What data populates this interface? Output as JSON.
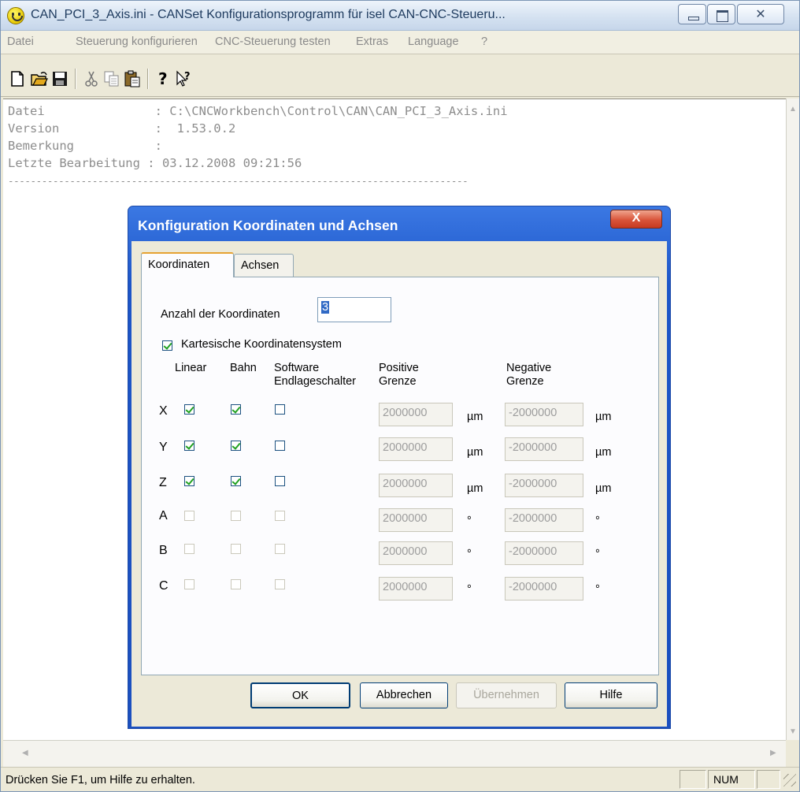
{
  "window": {
    "title": "CAN_PCI_3_Axis.ini - CANSet Konfigurationsprogramm für isel CAN-CNC-Steueru...",
    "close_glyph": "✕"
  },
  "menu": [
    "Datei",
    "Steuerung konfigurieren",
    "CNC-Steuerung testen",
    "Extras",
    "Language",
    "?"
  ],
  "toolbar": [
    "new-icon",
    "open-icon",
    "save-icon",
    "cut-icon",
    "copy-icon",
    "paste-icon",
    "help-icon",
    "context-help-icon"
  ],
  "editor": {
    "lines": [
      "Datei               : C:\\CNCWorkbench\\Control\\CAN\\CAN_PCI_3_Axis.ini",
      "Version             :  1.53.0.2",
      "Bemerkung           :",
      "Letzte Bearbeitung : 03.12.2008 09:21:56",
      "----------------------------------------------------------------------------------"
    ]
  },
  "status": {
    "text": "Drücken Sie F1, um Hilfe zu erhalten.",
    "num": "NUM"
  },
  "dialog": {
    "title": "Konfiguration Koordinaten und Achsen",
    "close_glyph": "X",
    "tabs": [
      "Koordinaten",
      "Achsen"
    ],
    "count_label": "Anzahl der Koordinaten",
    "count_value": "3",
    "cartesian_label": "Kartesische Koordinatensystem",
    "cartesian_checked": true,
    "headers": {
      "linear": "Linear",
      "bahn": "Bahn",
      "software": "Software",
      "endlage": "Endlageschalter",
      "positive": "Positive",
      "negative": "Negative",
      "grenze": "Grenze"
    },
    "rows": [
      {
        "axis": "X",
        "linear": true,
        "bahn": true,
        "soft": false,
        "enabled": true,
        "pos": "2000000",
        "neg": "-2000000",
        "unit": "µm"
      },
      {
        "axis": "Y",
        "linear": true,
        "bahn": true,
        "soft": false,
        "enabled": true,
        "pos": "2000000",
        "neg": "-2000000",
        "unit": "µm"
      },
      {
        "axis": "Z",
        "linear": true,
        "bahn": true,
        "soft": false,
        "enabled": true,
        "pos": "2000000",
        "neg": "-2000000",
        "unit": "µm"
      },
      {
        "axis": "A",
        "linear": false,
        "bahn": false,
        "soft": false,
        "enabled": false,
        "pos": "2000000",
        "neg": "-2000000",
        "unit": "°"
      },
      {
        "axis": "B",
        "linear": false,
        "bahn": false,
        "soft": false,
        "enabled": false,
        "pos": "2000000",
        "neg": "-2000000",
        "unit": "°"
      },
      {
        "axis": "C",
        "linear": false,
        "bahn": false,
        "soft": false,
        "enabled": false,
        "pos": "2000000",
        "neg": "-2000000",
        "unit": "°"
      }
    ],
    "buttons": {
      "ok": "OK",
      "cancel": "Abbrechen",
      "apply": "Übernehmen",
      "help": "Hilfe"
    }
  }
}
